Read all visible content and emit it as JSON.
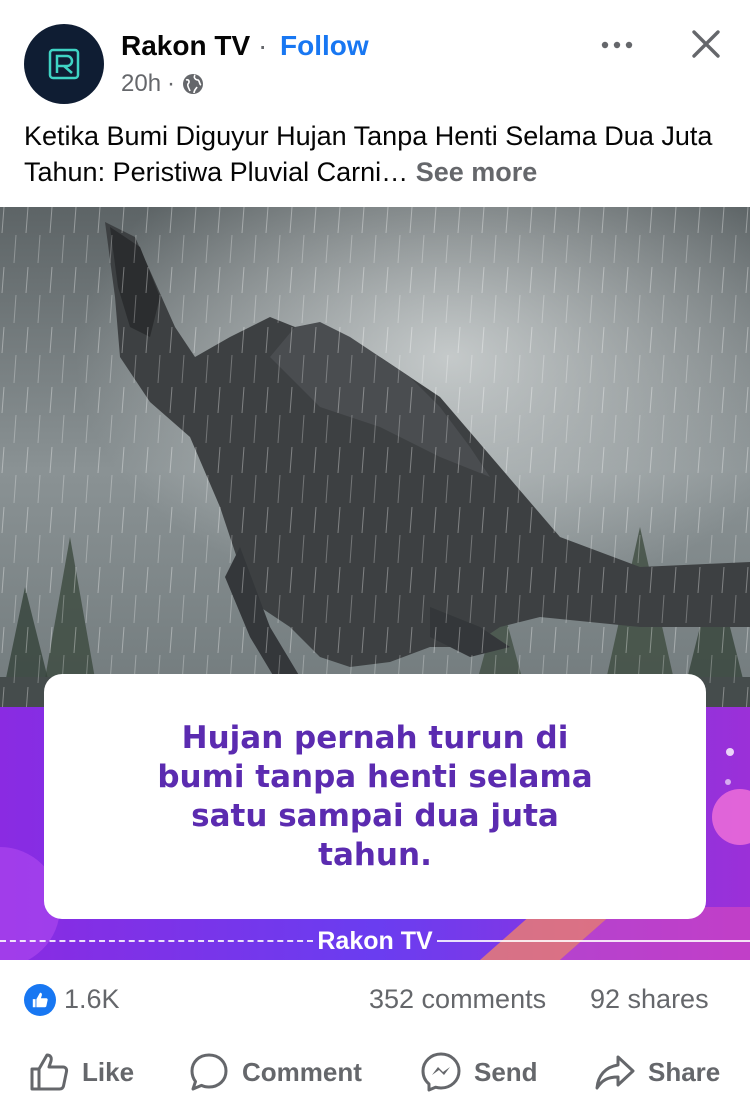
{
  "post": {
    "page_name": "Rakon TV",
    "separator": "·",
    "follow_label": "Follow",
    "time": "20h",
    "time_separator": "·",
    "audience_icon": "globe-icon",
    "more_icon": "more-horizontal-icon",
    "close_icon": "close-icon",
    "avatar_icon": "rakon-logo-icon"
  },
  "caption": {
    "text": "Ketika Bumi Diguyur Hujan Tanpa Henti Selama Dua Juta Tahun: Peristiwa Pluvial Carni…",
    "see_more": "See more"
  },
  "image": {
    "quote": "Hujan pernah turun di bumi tanpa henti selama satu sampai dua juta tahun.",
    "brand": "Rakon TV",
    "colors": {
      "quote_text": "#5b2bb0",
      "banner_purple": "#8a2be2",
      "banner_violet": "#6a3df0",
      "banner_pink": "#e84db8"
    }
  },
  "stats": {
    "reaction_icon": "thumbs-up-icon",
    "likes": "1.6K",
    "comments": "352 comments",
    "shares": "92 shares"
  },
  "actions": {
    "like": "Like",
    "comment": "Comment",
    "send": "Send",
    "share": "Share"
  },
  "colors": {
    "accent": "#1877f2",
    "secondary_text": "#65676b",
    "primary_text": "#050505"
  }
}
